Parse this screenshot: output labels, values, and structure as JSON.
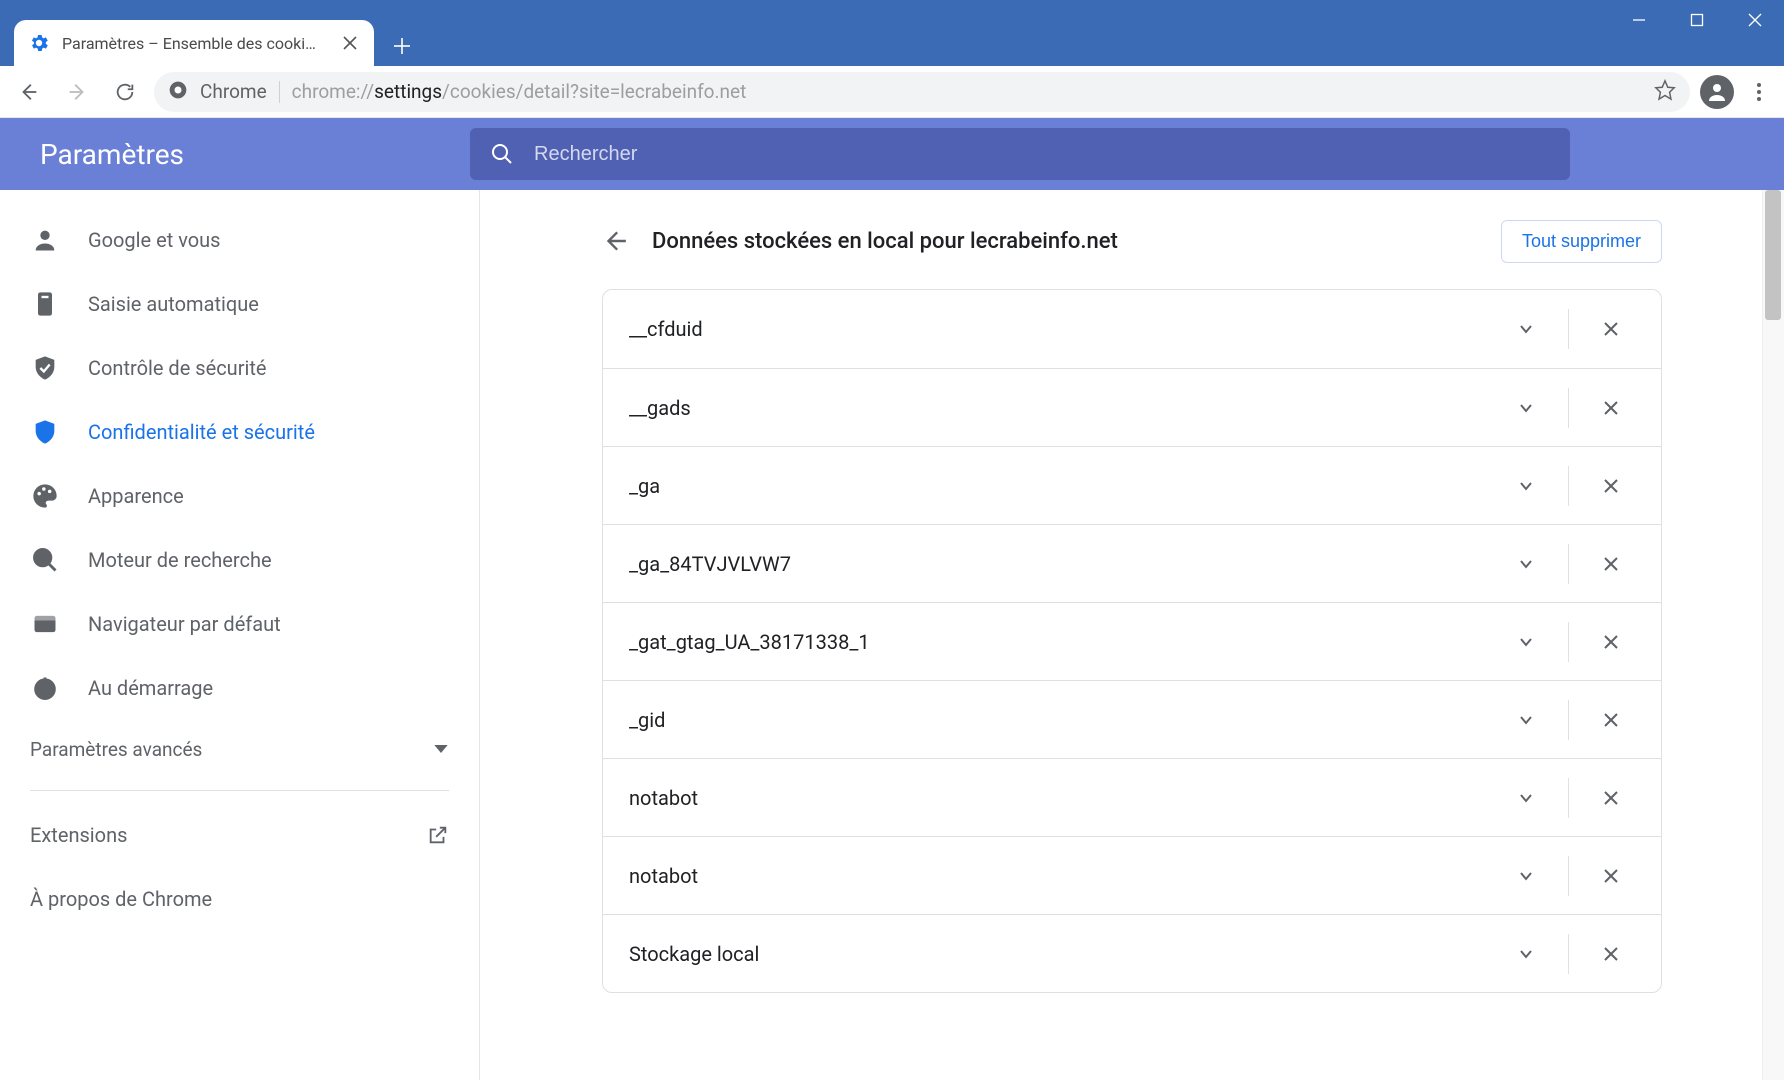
{
  "window": {
    "tab_title": "Paramètres – Ensemble des cooki…"
  },
  "omnibox": {
    "scheme_label": "Chrome",
    "url_prefix": "chrome://",
    "url_mid": "settings",
    "url_suffix": "/cookies/detail?site=lecrabeinfo.net"
  },
  "settings": {
    "header_title": "Paramètres",
    "search_placeholder": "Rechercher"
  },
  "sidebar": {
    "items": [
      {
        "id": "google",
        "label": "Google et vous"
      },
      {
        "id": "autofill",
        "label": "Saisie automatique"
      },
      {
        "id": "security",
        "label": "Contrôle de sécurité"
      },
      {
        "id": "privacy",
        "label": "Confidentialité et sécurité"
      },
      {
        "id": "appearance",
        "label": "Apparence"
      },
      {
        "id": "search",
        "label": "Moteur de recherche"
      },
      {
        "id": "defaultbrowser",
        "label": "Navigateur par défaut"
      },
      {
        "id": "startup",
        "label": "Au démarrage"
      }
    ],
    "advanced": "Paramètres avancés",
    "extensions": "Extensions",
    "about": "À propos de Chrome",
    "active_index": 3
  },
  "page": {
    "title": "Données stockées en local pour lecrabeinfo.net",
    "delete_all": "Tout supprimer",
    "cookies": [
      "__cfduid",
      "__gads",
      "_ga",
      "_ga_84TVJVLVW7",
      "_gat_gtag_UA_38171338_1",
      "_gid",
      "notabot",
      "notabot",
      "Stockage local"
    ]
  }
}
